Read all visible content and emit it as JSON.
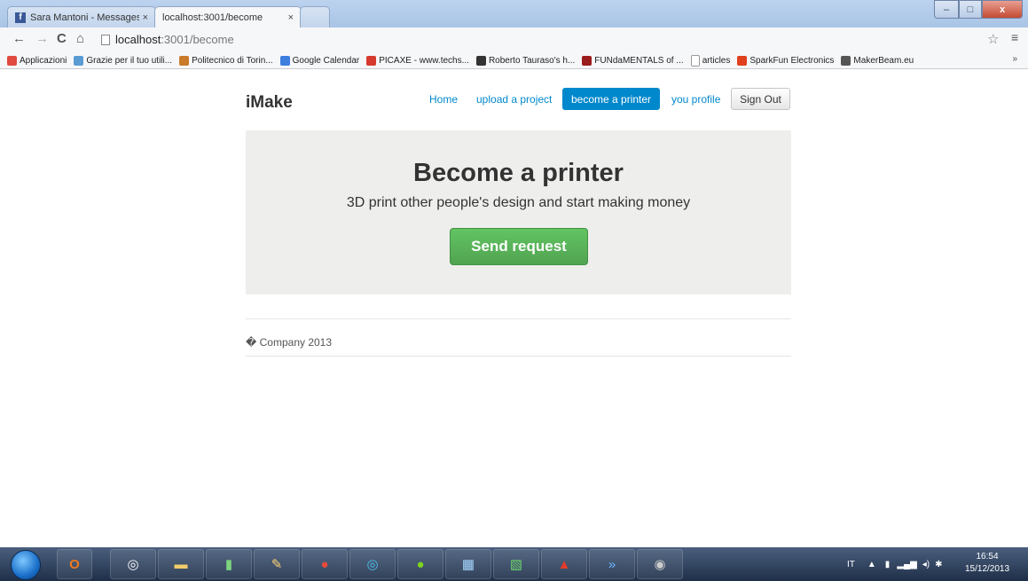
{
  "browser": {
    "tabs": [
      {
        "title": "Sara Mantoni - Messages",
        "close": "×"
      },
      {
        "title": "localhost:3001/become",
        "close": "×"
      }
    ],
    "window_controls": {
      "min": "–",
      "max": "□",
      "close": "x"
    },
    "nav": {
      "back": "←",
      "forward": "→",
      "reload": "C",
      "home": "⌂"
    },
    "url": {
      "host": "localhost",
      "path": ":3001/become"
    },
    "star": "☆",
    "menu": "≡",
    "bookmarks": [
      {
        "label": "Applicazioni",
        "color": "#e04a3f"
      },
      {
        "label": "Grazie per il tuo utili...",
        "color": "#5a9bd4"
      },
      {
        "label": "Politecnico di Torin...",
        "color": "#c97b2a"
      },
      {
        "label": "Google Calendar",
        "color": "#3d7ede"
      },
      {
        "label": "PICAXE - www.techs...",
        "color": "#d63a2e"
      },
      {
        "label": "Roberto Tauraso's h...",
        "color": "#333333"
      },
      {
        "label": "FUNdaMENTALS of ...",
        "color": "#9b1c1c"
      },
      {
        "label": "articles",
        "color": "#ffffff"
      },
      {
        "label": "SparkFun Electronics",
        "color": "#e0401c"
      },
      {
        "label": "MakerBeam.eu",
        "color": "#555555"
      }
    ],
    "bookmarks_more": "»"
  },
  "site": {
    "brand": "iMake",
    "nav": {
      "home": "Home",
      "upload": "upload a project",
      "become": "become a printer",
      "profile": "you profile",
      "signout": "Sign Out"
    },
    "hero": {
      "title": "Become a printer",
      "subtitle": "3D print other people's design and start making money",
      "button": "Send request"
    },
    "footer": "� Company 2013"
  },
  "taskbar": {
    "lang": "IT",
    "time": "16:54",
    "date": "15/12/2013"
  },
  "colors": {
    "link": "#0088cc",
    "button_green": "#51a351",
    "hero_bg": "#eeeeec"
  }
}
